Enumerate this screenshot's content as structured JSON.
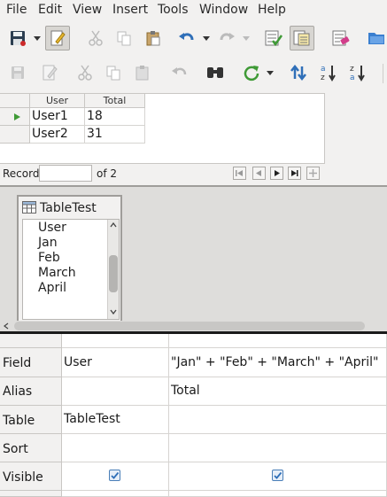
{
  "menu": [
    "File",
    "Edit",
    "View",
    "Insert",
    "Tools",
    "Window",
    "Help"
  ],
  "toolbar1": [
    "save",
    "edit-mode",
    "cut",
    "copy",
    "paste",
    "undo",
    "redo",
    "add-tables",
    "design-view",
    "clear-query",
    "switch-design",
    "close"
  ],
  "toolbar2": [
    "save-record",
    "edit-data",
    "cut",
    "copy",
    "paste",
    "undo",
    "find",
    "refresh",
    "sort",
    "sort-ascending",
    "sort-descending",
    "separator"
  ],
  "results": {
    "columns": [
      "User",
      "Total"
    ],
    "rows": [
      {
        "user": "User1",
        "total": "18"
      },
      {
        "user": "User2",
        "total": "31"
      }
    ]
  },
  "record_nav": {
    "label": "Record",
    "current": "",
    "of_text": "of 2"
  },
  "table_window": {
    "title": "TableTest",
    "fields": [
      "User",
      "Jan",
      "Feb",
      "March",
      "April"
    ]
  },
  "design_grid": {
    "row_labels": {
      "field": "Field",
      "alias": "Alias",
      "table": "Table",
      "sort": "Sort",
      "visible": "Visible"
    },
    "columns": [
      {
        "field": "User",
        "alias": "",
        "table": "TableTest",
        "sort": "",
        "visible": true
      },
      {
        "field": "\"Jan\" + \"Feb\" + \"March\" + \"April\"",
        "alias": "Total",
        "table": "",
        "sort": "",
        "visible": true
      }
    ]
  },
  "colors": {
    "accent_blue": "#2f6fb8",
    "save_red": "#cc2a2a",
    "refresh_green": "#3f9a36",
    "checkbox_border": "#4a7fb8"
  }
}
